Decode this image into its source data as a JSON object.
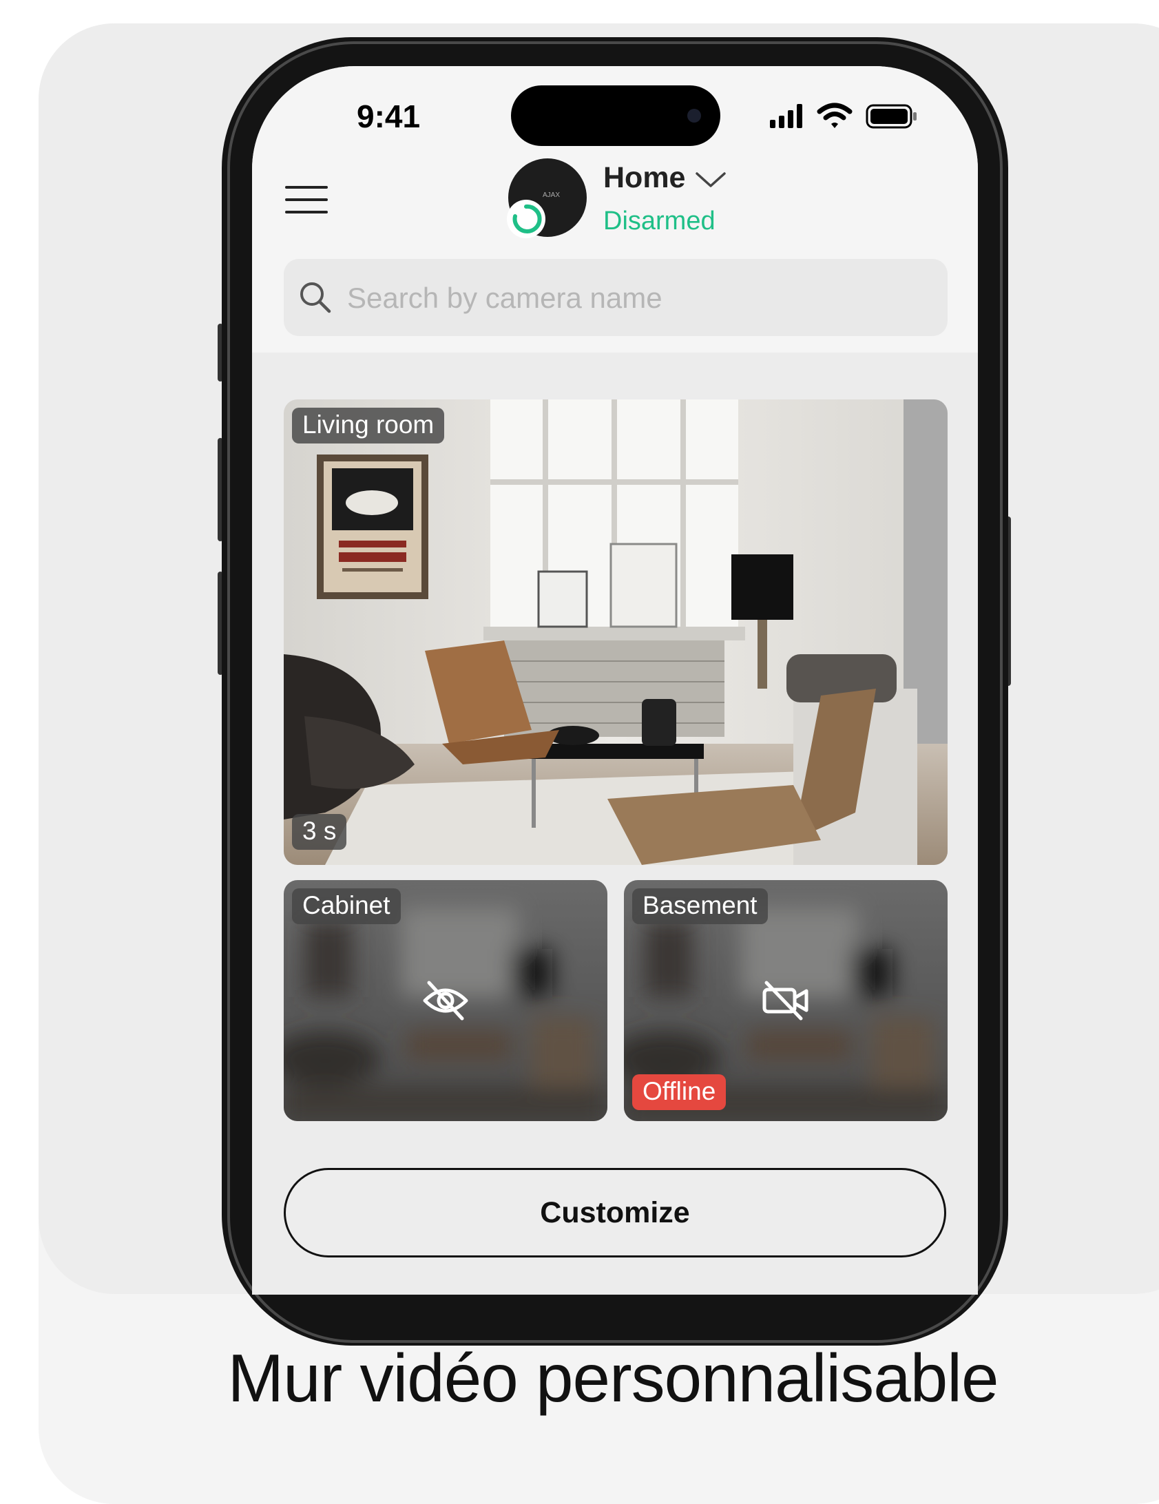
{
  "status_bar": {
    "time": "9:41"
  },
  "header": {
    "hub_name": "Home",
    "hub_status": "Disarmed",
    "hub_logo_text": "AJAX",
    "status_color": "#1fbf87"
  },
  "search": {
    "placeholder": "Search by camera name",
    "value": ""
  },
  "cameras": [
    {
      "name": "Living room",
      "duration": "3 s",
      "state": "live"
    },
    {
      "name": "Cabinet",
      "state": "privacy",
      "icon": "eye-off-icon"
    },
    {
      "name": "Basement",
      "state": "offline",
      "icon": "video-off-icon",
      "status_label": "Offline",
      "status_color": "#e5483f"
    }
  ],
  "customize_label": "Customize",
  "caption": "Mur vidéo personnalisable"
}
